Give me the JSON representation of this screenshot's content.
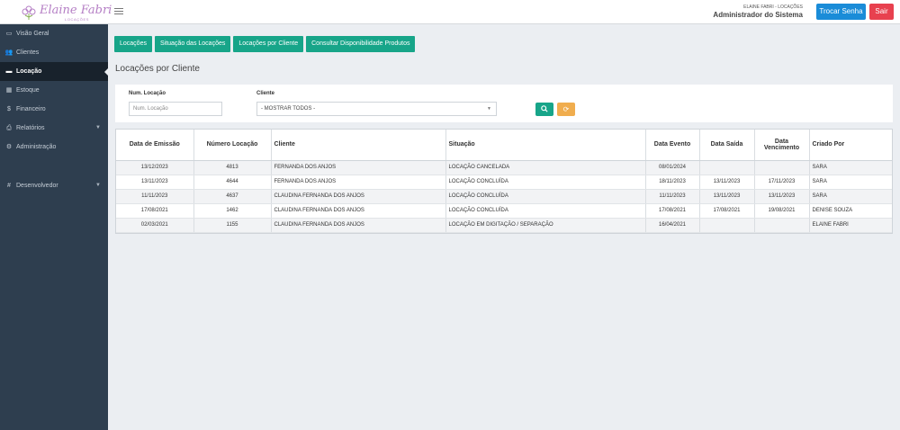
{
  "brand": {
    "logo_text": "Elaine Fabri",
    "logo_sub": "LOCAÇÕES"
  },
  "header": {
    "company": "ELAINE FABRI - LOCAÇÕES",
    "role": "Administrador do Sistema",
    "change_password_label": "Trocar Senha",
    "logout_label": "Sair"
  },
  "sidebar": {
    "items": [
      {
        "label": "Visão Geral",
        "icon": "monitor-icon"
      },
      {
        "label": "Clientes",
        "icon": "users-icon"
      },
      {
        "label": "Locação",
        "icon": "card-icon"
      },
      {
        "label": "Estoque",
        "icon": "grid-icon"
      },
      {
        "label": "Financeiro",
        "icon": "dollar-icon"
      },
      {
        "label": "Relatórios",
        "icon": "print-icon"
      },
      {
        "label": "Administração",
        "icon": "gear-icon"
      },
      {
        "label": "Desenvolvedor",
        "icon": "hash-icon"
      }
    ],
    "active_index": 2
  },
  "tabs": [
    {
      "label": "Locações"
    },
    {
      "label": "Situação das Locações"
    },
    {
      "label": "Locações por Cliente"
    },
    {
      "label": "Consultar Disponibilidade Produtos"
    }
  ],
  "page_title": "Locações por Cliente",
  "filters": {
    "num_label": "Num. Locação",
    "num_placeholder": "Num. Locação",
    "client_label": "Cliente",
    "client_value": "- MOSTRAR TODOS -"
  },
  "table": {
    "headers": [
      "Data de Emissão",
      "Número Locação",
      "Cliente",
      "Situação",
      "Data Evento",
      "Data Saída",
      "Data Vencimento",
      "Criado Por"
    ],
    "rows": [
      [
        "13/12/2023",
        "4813",
        "FERNANDA DOS ANJOS",
        "LOCAÇÃO CANCELADA",
        "08/01/2024",
        "",
        "",
        "SARA"
      ],
      [
        "13/11/2023",
        "4644",
        "FERNANDA DOS ANJOS",
        "LOCAÇÃO CONCLUÍDA",
        "18/11/2023",
        "13/11/2023",
        "17/11/2023",
        "SARA"
      ],
      [
        "11/11/2023",
        "4637",
        "CLAUDINA FERNANDA DOS ANJOS",
        "LOCAÇÃO CONCLUÍDA",
        "11/11/2023",
        "13/11/2023",
        "13/11/2023",
        "SARA"
      ],
      [
        "17/08/2021",
        "1462",
        "CLAUDINA FERNANDA DOS ANJOS",
        "LOCAÇÃO CONCLUÍDA",
        "17/08/2021",
        "17/08/2021",
        "19/08/2021",
        "DENISE SOUZA"
      ],
      [
        "02/03/2021",
        "1155",
        "CLAUDINA FERNANDA DOS ANJOS",
        "LOCAÇÃO EM DIGITAÇÃO / SEPARAÇÃO",
        "16/04/2021",
        "",
        "",
        "ELAINE FABRI"
      ]
    ]
  },
  "colors": {
    "sidebar_bg": "#2e3e4f",
    "accent_green": "#17a589",
    "primary_blue": "#1a8cd8",
    "danger_red": "#e8414f",
    "warning_orange": "#f0ad4e"
  }
}
